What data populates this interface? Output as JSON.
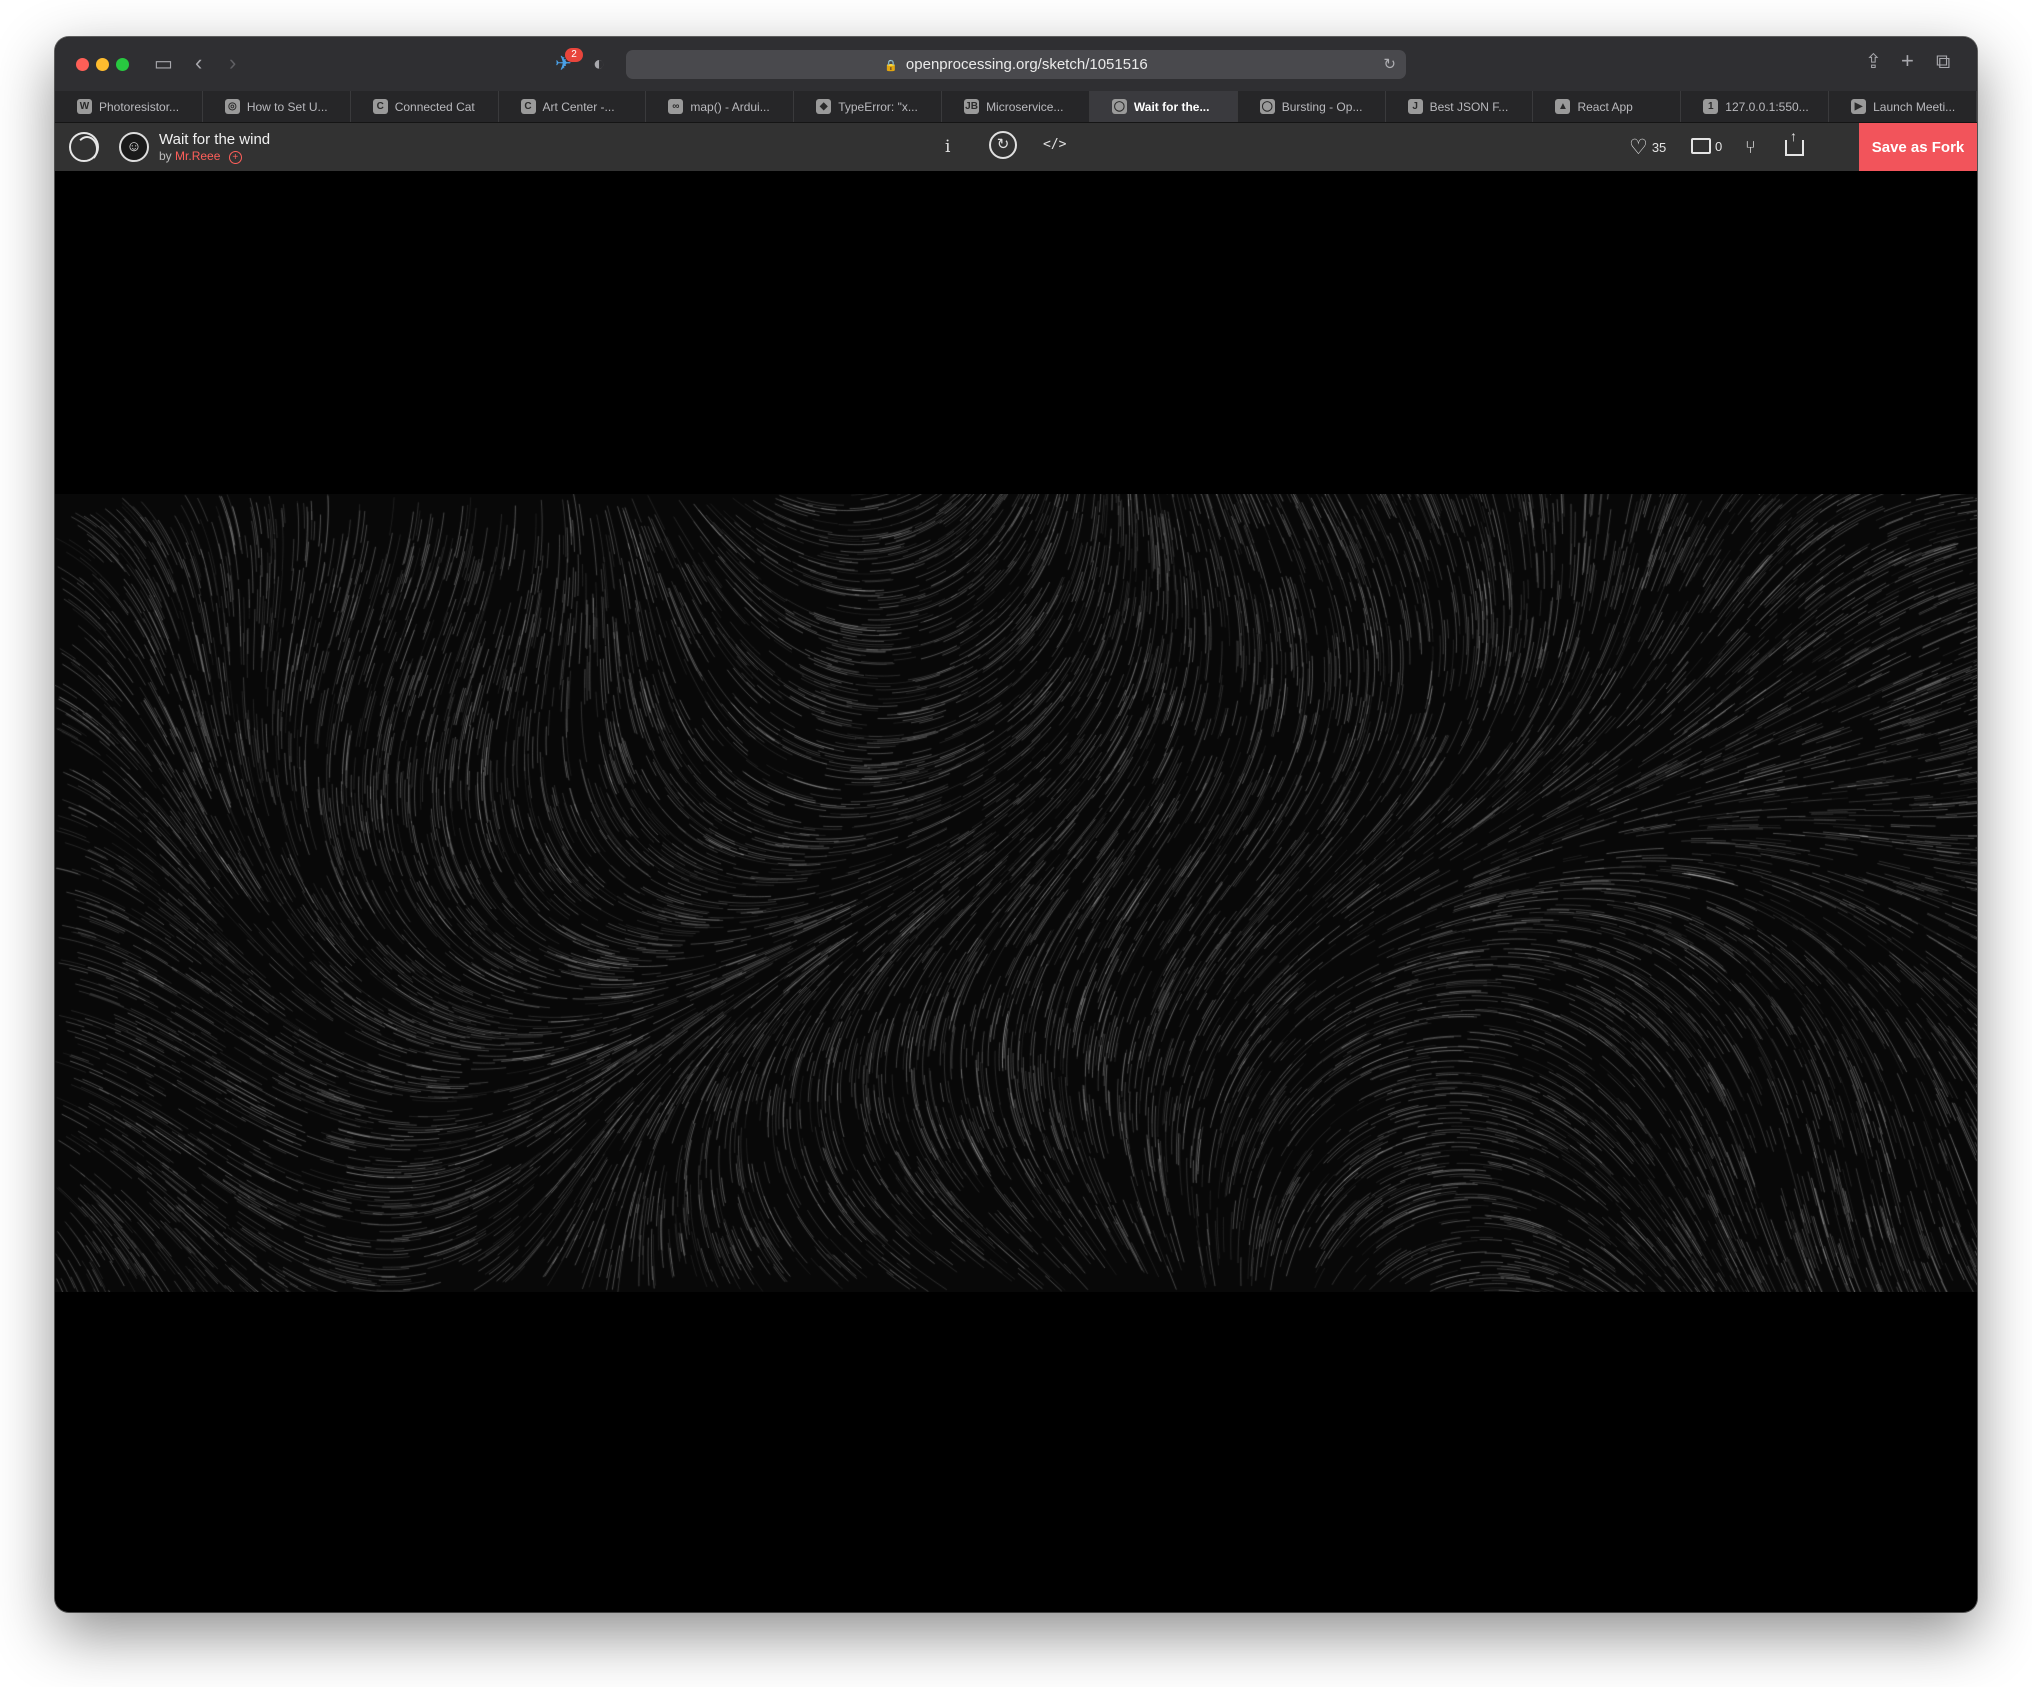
{
  "browser": {
    "url": "openprocessing.org/sketch/1051516",
    "extension_badge": "2",
    "tabs": [
      {
        "label": "Photoresistor...",
        "icon": "W",
        "active": false
      },
      {
        "label": "How to Set U...",
        "icon": "◎",
        "active": false
      },
      {
        "label": "Connected Cat",
        "icon": "C",
        "active": false
      },
      {
        "label": "Art Center -...",
        "icon": "C",
        "active": false
      },
      {
        "label": "map() - Ardui...",
        "icon": "∞",
        "active": false
      },
      {
        "label": "TypeError: \"x...",
        "icon": "◆",
        "active": false
      },
      {
        "label": "Microservice...",
        "icon": "JB",
        "active": false
      },
      {
        "label": "Wait for the...",
        "icon": "◯",
        "active": true
      },
      {
        "label": "Bursting - Op...",
        "icon": "◯",
        "active": false
      },
      {
        "label": "Best JSON F...",
        "icon": "J",
        "active": false
      },
      {
        "label": "React App",
        "icon": "▲",
        "active": false
      },
      {
        "label": "127.0.0.1:550...",
        "icon": "1",
        "active": false
      },
      {
        "label": "Launch Meeti...",
        "icon": "▶",
        "active": false
      }
    ]
  },
  "sketch": {
    "title": "Wait for the wind",
    "by_prefix": "by",
    "author": "Mr.Reee",
    "likes": "35",
    "comments": "0",
    "fork_button": "Save as Fork",
    "info_label": "i",
    "code_label": "</>"
  },
  "colors": {
    "accent": "#f2545b",
    "author_link": "#ff5f5a",
    "toolbar_bg": "#323232",
    "canvas_bg": "#000000"
  }
}
